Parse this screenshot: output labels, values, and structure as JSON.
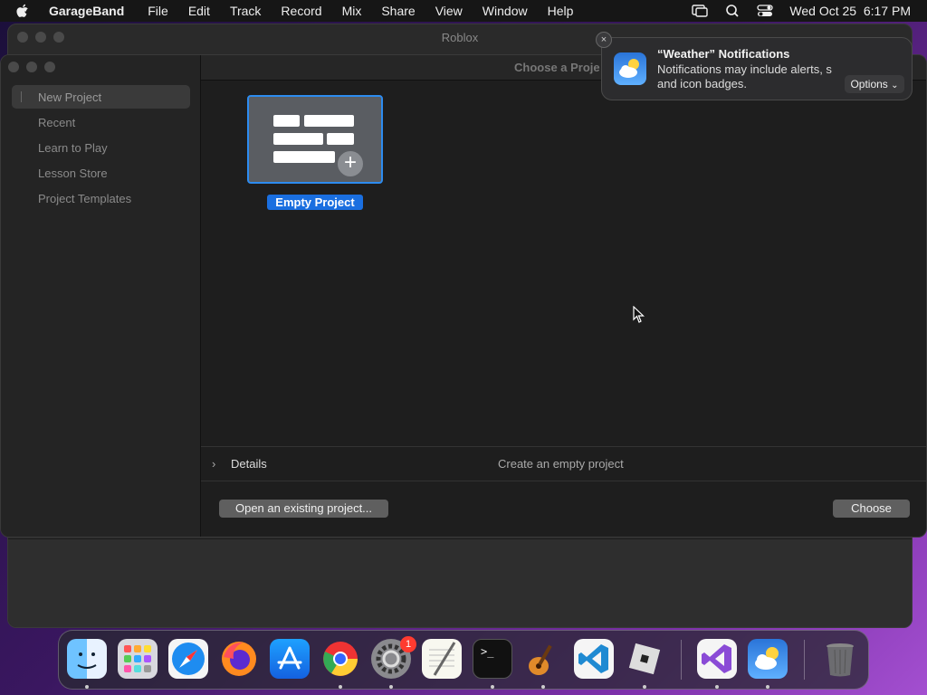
{
  "menubar": {
    "app_name": "GarageBand",
    "items": [
      "File",
      "Edit",
      "Track",
      "Record",
      "Mix",
      "Share",
      "View",
      "Window",
      "Help"
    ],
    "datetime": "Wed Oct 25  6:17 PM"
  },
  "background_window": {
    "title": "Roblox"
  },
  "dialog": {
    "title": "Choose a Proje",
    "sidebar": [
      "New Project",
      "Recent",
      "Learn to Play",
      "Lesson Store",
      "Project Templates"
    ],
    "selected": "New Project",
    "tile_label": "Empty Project",
    "details_label": "Details",
    "details_desc": "Create an empty project",
    "open_button": "Open an existing project...",
    "choose_button": "Choose"
  },
  "notification": {
    "title": "“Weather” Notifications",
    "body_line1": "Notifications may include alerts, s",
    "body_line2": "and icon badges.",
    "options": "Options",
    "close": "×"
  },
  "dock": {
    "system_preferences_badge": "1",
    "terminal_glyph": ">_"
  },
  "colors": {
    "accent": "#1a6fe0",
    "selection_border": "#2d8cf0"
  }
}
